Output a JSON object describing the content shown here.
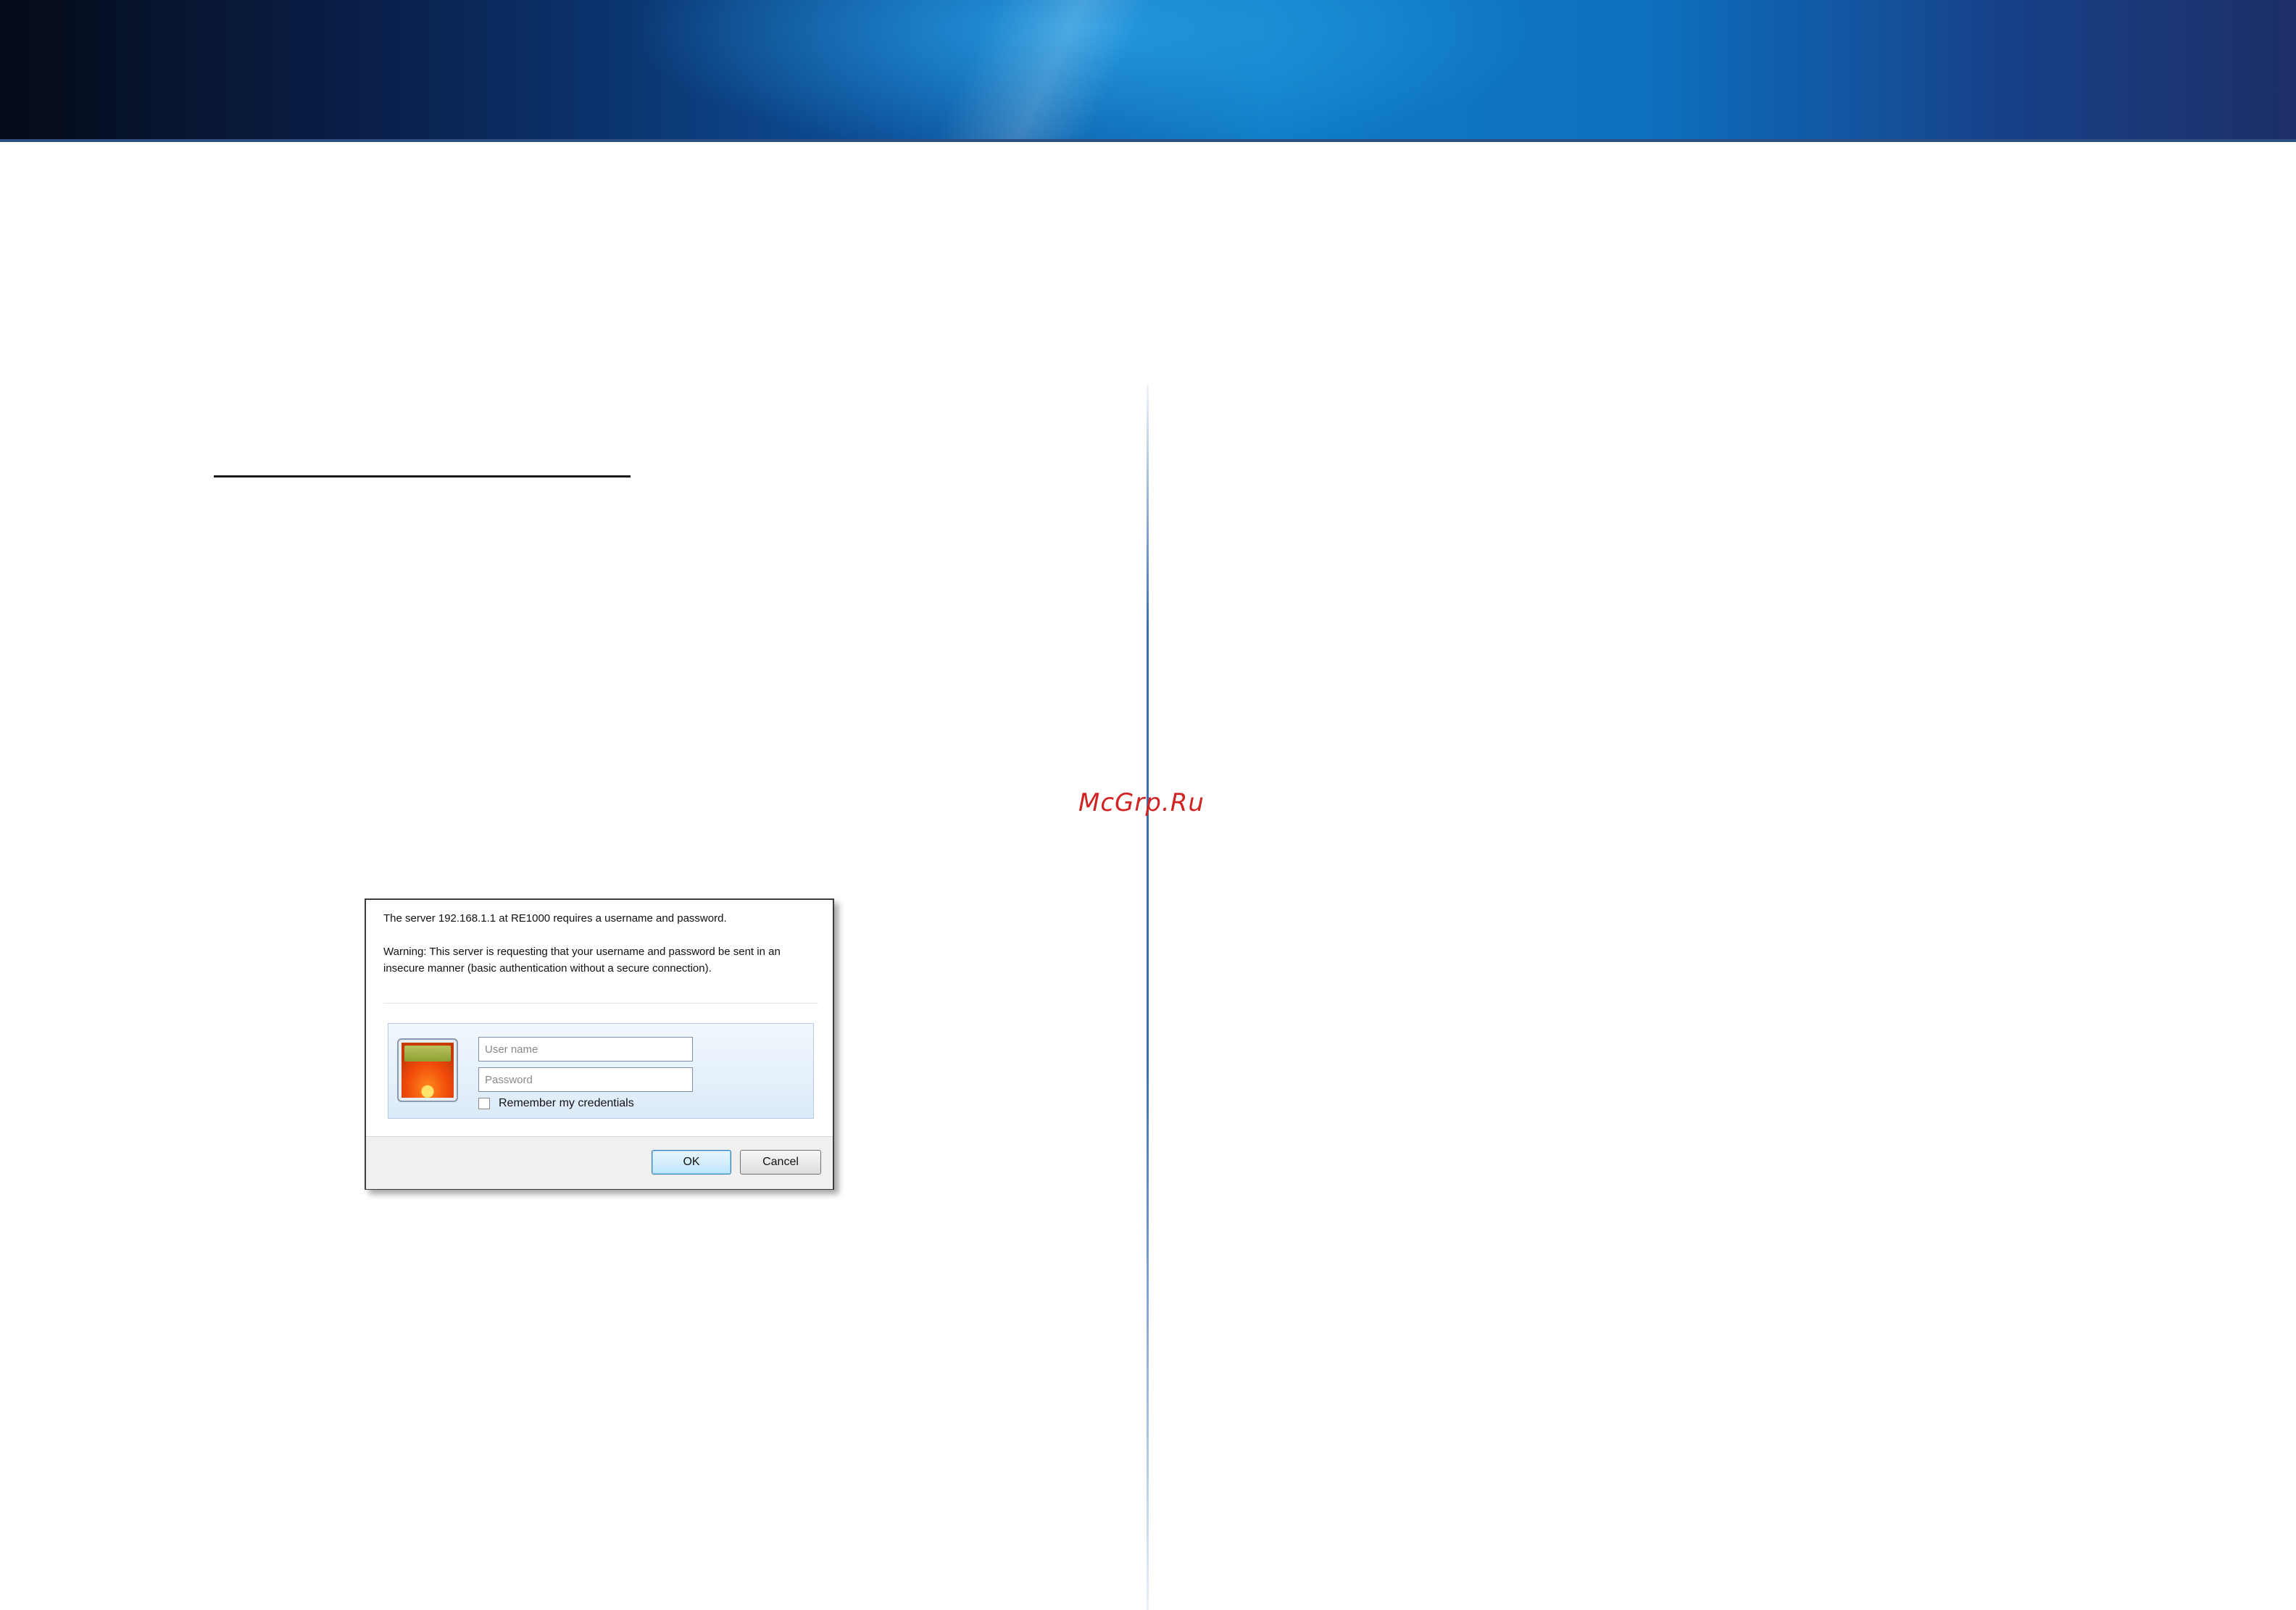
{
  "watermark": "McGrp.Ru",
  "login_dialog": {
    "server_message": "The server 192.168.1.1 at RE1000 requires a username and password.",
    "warning_message": "Warning: This server is requesting that your username and password be sent in an insecure manner (basic authentication without a secure connection).",
    "username_placeholder": "User name",
    "password_placeholder": "Password",
    "remember_label": "Remember my credentials",
    "ok_label": "OK",
    "cancel_label": "Cancel"
  }
}
